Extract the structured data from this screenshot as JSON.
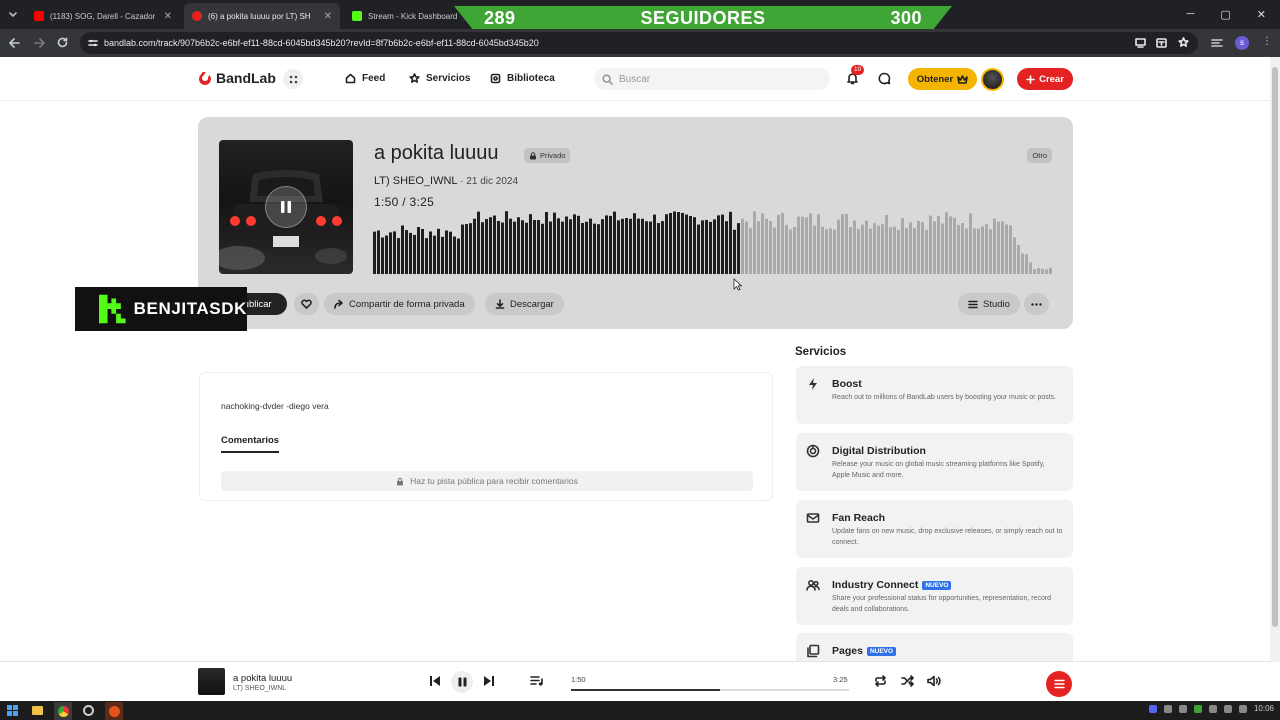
{
  "browser": {
    "tabs": [
      {
        "title": "(1183) SOG, Darell - Cazador (V",
        "active": false
      },
      {
        "title": "(6) a pokita luuuu por LT) SH",
        "active": true
      },
      {
        "title": "Stream - Kick Dashboard",
        "active": false
      }
    ],
    "url": "bandlab.com/track/907b6b2c-e6bf-ef11-88cd-6045bd345b20?revId=8f7b6b2c-e6bf-ef11-88cd-6045bd345b20"
  },
  "overlay": {
    "followers_left": "289",
    "followers_label": "SEGUIDORES",
    "followers_right": "300",
    "streamer": "BENJITASDK"
  },
  "header": {
    "logo": "BandLab",
    "nav": [
      "Feed",
      "Servicios",
      "Biblioteca"
    ],
    "search_placeholder": "Buscar",
    "notif_count": "10",
    "obtener": "Obtener",
    "crear": "Crear"
  },
  "track": {
    "title": "a pokita luuuu",
    "privacy": "Privado",
    "genre": "Otro",
    "artist": "LT) SHEO_IWNL",
    "date": "· 21 dic 2024",
    "current": "1:50",
    "separator": "/",
    "duration": "3:25",
    "progress": 0.537,
    "actions": {
      "publish": "Publicar",
      "share": "Compartir de forma privada",
      "download": "Descargar",
      "studio": "Studio"
    }
  },
  "description": "nachoking-dvder -diego vera",
  "comments": {
    "tab": "Comentarios",
    "notice": "Haz tu pista pública para recibir comentarios"
  },
  "services": {
    "title": "Servicios",
    "items": [
      {
        "icon": "bolt-icon",
        "name": "Boost",
        "desc": "Reach out to millions of BandLab users by boosting your music or posts.",
        "badge": ""
      },
      {
        "icon": "distribution-icon",
        "name": "Digital Distribution",
        "desc": "Release your music on global music streaming platforms like Spotify, Apple Music and more.",
        "badge": ""
      },
      {
        "icon": "mail-icon",
        "name": "Fan Reach",
        "desc": "Update fans on new music, drop exclusive releases, or simply reach out to connect.",
        "badge": ""
      },
      {
        "icon": "people-icon",
        "name": "Industry Connect",
        "desc": "Share your professional status for opportunities, representation, record deals and collaborations.",
        "badge": "NUEVO"
      },
      {
        "icon": "pages-icon",
        "name": "Pages",
        "desc": "",
        "badge": "NUEVO"
      }
    ]
  },
  "player": {
    "title": "a pokita luuuu",
    "artist": "LT) SHEO_IWNL",
    "current": "1:50",
    "duration": "3:25"
  },
  "taskbar": {
    "clock": "10:06"
  },
  "colors": {
    "accent_red": "#e52222",
    "obtener_yellow": "#f5b400",
    "kick_green": "#53fc18",
    "nuevo_blue": "#2f72e8"
  }
}
